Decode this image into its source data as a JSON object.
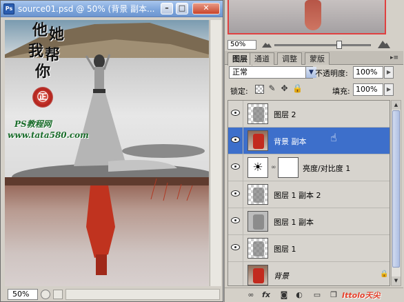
{
  "document": {
    "title": "source01.psd @ 50% (背景 副本...",
    "app_icon": "Ps",
    "zoom": "50%",
    "canvas_text": {
      "calligraphy": [
        "他",
        "她",
        "我",
        "帮",
        "你"
      ],
      "seal": "㊣",
      "watermark_line1": "PS教程网",
      "watermark_line2": "www.tata580.com"
    }
  },
  "navigator": {
    "zoom": "50%"
  },
  "layers_panel": {
    "tabs": [
      "图层",
      "通道",
      "调整",
      "蒙版"
    ],
    "menu_glyph": "▸≡",
    "blend_mode": "正常",
    "opacity_label": "不透明度:",
    "opacity_value": "100%",
    "lock_label": "锁定:",
    "fill_label": "填充:",
    "fill_value": "100%",
    "layers": [
      {
        "name": "图层 2",
        "visible": true,
        "selected": false
      },
      {
        "name": "背景 副本",
        "visible": true,
        "selected": true
      },
      {
        "name": "亮度/对比度 1",
        "visible": true,
        "selected": false
      },
      {
        "name": "图层 1 副本 2",
        "visible": true,
        "selected": false
      },
      {
        "name": "图层 1 副本",
        "visible": true,
        "selected": false
      },
      {
        "name": "图层 1",
        "visible": true,
        "selected": false
      },
      {
        "name": "背景",
        "visible": false,
        "selected": false
      }
    ],
    "footer_watermark": "Ittolo天尖"
  },
  "colors": {
    "selection": "#3d6fcb",
    "titlebar": "#7ea6dc",
    "panel_bg": "#d4d0c8"
  }
}
